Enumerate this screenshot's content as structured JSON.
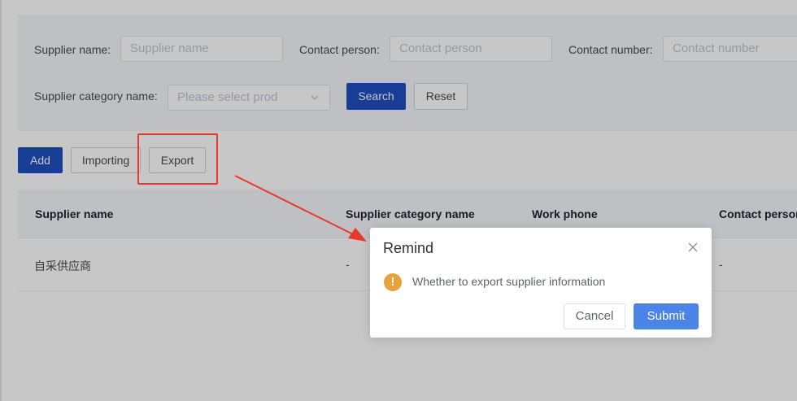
{
  "filters": {
    "supplier_name": {
      "label": "Supplier name:",
      "placeholder": "Supplier name"
    },
    "contact_person": {
      "label": "Contact person:",
      "placeholder": "Contact person"
    },
    "contact_number": {
      "label": "Contact number:",
      "placeholder": "Contact number"
    },
    "category": {
      "label": "Supplier category name:",
      "placeholder": "Please select prod"
    },
    "search_label": "Search",
    "reset_label": "Reset"
  },
  "toolbar": {
    "add_label": "Add",
    "importing_label": "Importing",
    "export_label": "Export"
  },
  "table": {
    "columns": [
      "Supplier name",
      "Supplier category name",
      "Work phone",
      "Contact person"
    ],
    "rows": [
      {
        "supplier_name": "自采供应商",
        "category": "-",
        "work_phone": "",
        "contact_person": "-"
      }
    ]
  },
  "dialog": {
    "title": "Remind",
    "message": "Whether to export supplier information",
    "cancel_label": "Cancel",
    "submit_label": "Submit",
    "warning_icon_glyph": "!"
  },
  "colors": {
    "primary": "#1e4fbf",
    "submit": "#4a84e6",
    "warning": "#e6a23c",
    "annotation": "#e8382c"
  },
  "icons": {
    "select_arrow": "chevron-down-icon",
    "dialog_close": "close-icon",
    "dialog_warning": "warning-icon"
  }
}
